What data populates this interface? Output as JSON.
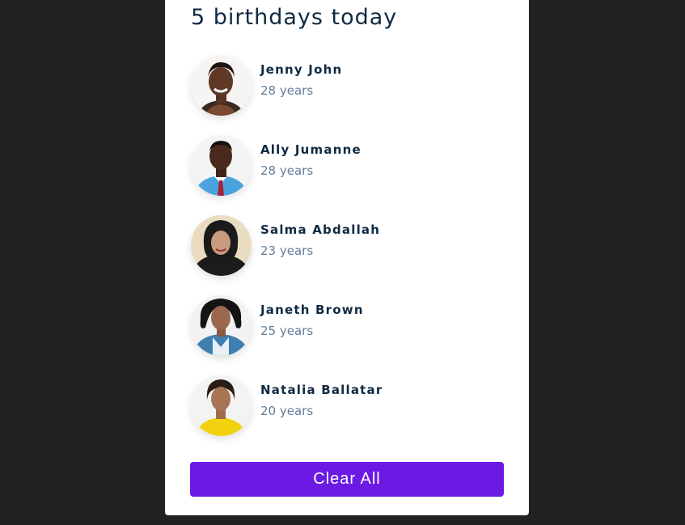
{
  "header": {
    "title": "5 birthdays today"
  },
  "people": [
    {
      "name": "Jenny John",
      "age": "28 years"
    },
    {
      "name": "Ally Jumanne",
      "age": "28 years"
    },
    {
      "name": "Salma Abdallah",
      "age": "23 years"
    },
    {
      "name": "Janeth Brown",
      "age": "25 years"
    },
    {
      "name": "Natalia Ballatar",
      "age": "20 years"
    }
  ],
  "actions": {
    "clear_label": "Clear All"
  },
  "colors": {
    "background": "#222222",
    "card": "#ffffff",
    "accent": "#6b19e3",
    "name_text": "#102a43",
    "age_text": "#627d98"
  }
}
